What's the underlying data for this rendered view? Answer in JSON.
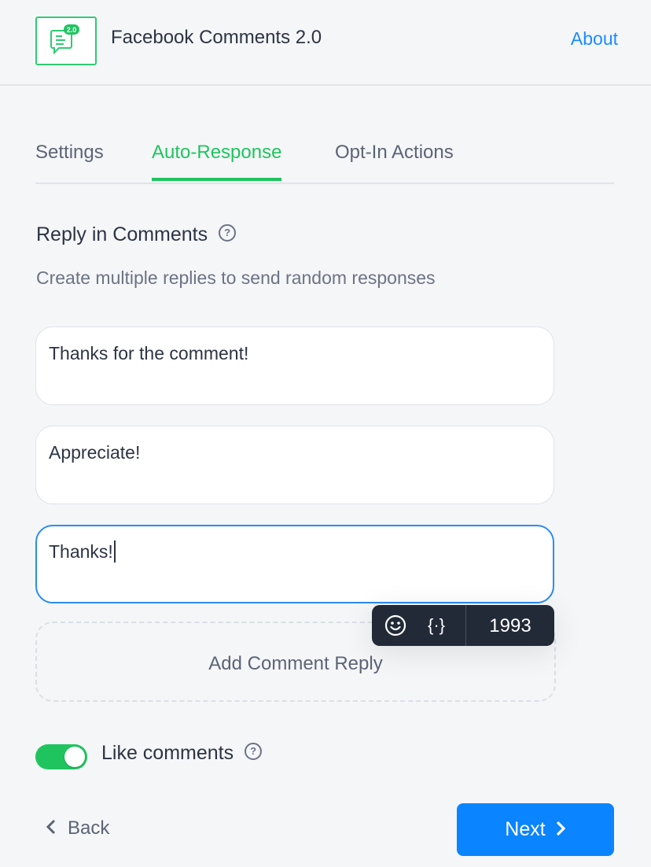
{
  "header": {
    "logo_badge": "2.0",
    "title": "Facebook Comments 2.0",
    "about_label": "About"
  },
  "tabs": [
    {
      "label": "Settings",
      "active": false
    },
    {
      "label": "Auto-Response",
      "active": true
    },
    {
      "label": "Opt-In Actions",
      "active": false
    }
  ],
  "section": {
    "title": "Reply in Comments",
    "help_glyph": "?",
    "description": "Create multiple replies to send random responses"
  },
  "replies": [
    {
      "value": "Thanks for the comment!"
    },
    {
      "value": "Appreciate!"
    },
    {
      "value": "Thanks!",
      "focused": true
    }
  ],
  "toolbar": {
    "emoji_icon": "☺",
    "variables_icon": "{·}",
    "char_count": "1993"
  },
  "add_reply_label": "Add Comment Reply",
  "like_toggle": {
    "label": "Like comments",
    "enabled": true,
    "help_glyph": "?"
  },
  "footer": {
    "back_label": "Back",
    "back_icon": "‹",
    "next_label": "Next",
    "next_icon": "›"
  },
  "colors": {
    "accent_green": "#1fc45f",
    "primary_blue": "#0a84ff",
    "link_blue": "#1a8cff",
    "toolbar_bg": "#222a37"
  }
}
